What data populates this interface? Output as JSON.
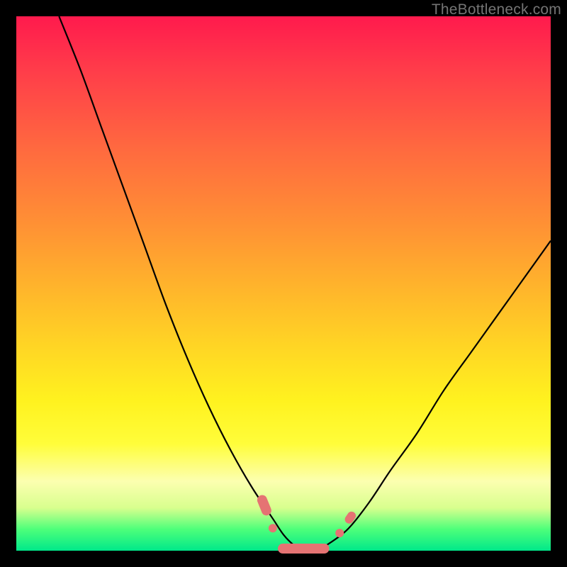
{
  "credit": "TheBottleneck.com",
  "colors": {
    "frame": "#000000",
    "curve": "#000000",
    "marker": "#e57373",
    "gradient_top": "#ff1a4d",
    "gradient_bottom": "#00e88a"
  },
  "chart_data": {
    "type": "line",
    "title": "",
    "xlabel": "",
    "ylabel": "",
    "xlim": [
      0,
      100
    ],
    "ylim": [
      0,
      100
    ],
    "series": [
      {
        "name": "bottleneck-curve",
        "x": [
          8,
          12,
          16,
          20,
          24,
          28,
          32,
          36,
          40,
          44,
          48,
          50,
          52,
          54,
          56,
          58,
          62,
          66,
          70,
          75,
          80,
          85,
          90,
          95,
          100
        ],
        "values": [
          100,
          90,
          79,
          68,
          57,
          46,
          36,
          27,
          19,
          12,
          6,
          3,
          1,
          0,
          0,
          1,
          4,
          9,
          15,
          22,
          30,
          37,
          44,
          51,
          58
        ]
      }
    ],
    "markers": [
      {
        "name": "left-cluster-1",
        "x": 46.0,
        "y": 8.5
      },
      {
        "name": "left-cluster-2",
        "x": 47.5,
        "y": 5.0
      },
      {
        "name": "bottom-1",
        "x": 50.0,
        "y": 1.2
      },
      {
        "name": "bottom-2",
        "x": 52.0,
        "y": 0.3
      },
      {
        "name": "bottom-3",
        "x": 54.0,
        "y": 0.1
      },
      {
        "name": "bottom-4",
        "x": 56.0,
        "y": 0.3
      },
      {
        "name": "bottom-5",
        "x": 57.5,
        "y": 0.9
      },
      {
        "name": "right-cluster-1",
        "x": 61.0,
        "y": 4.0
      },
      {
        "name": "right-cluster-2",
        "x": 62.5,
        "y": 6.0
      }
    ]
  }
}
